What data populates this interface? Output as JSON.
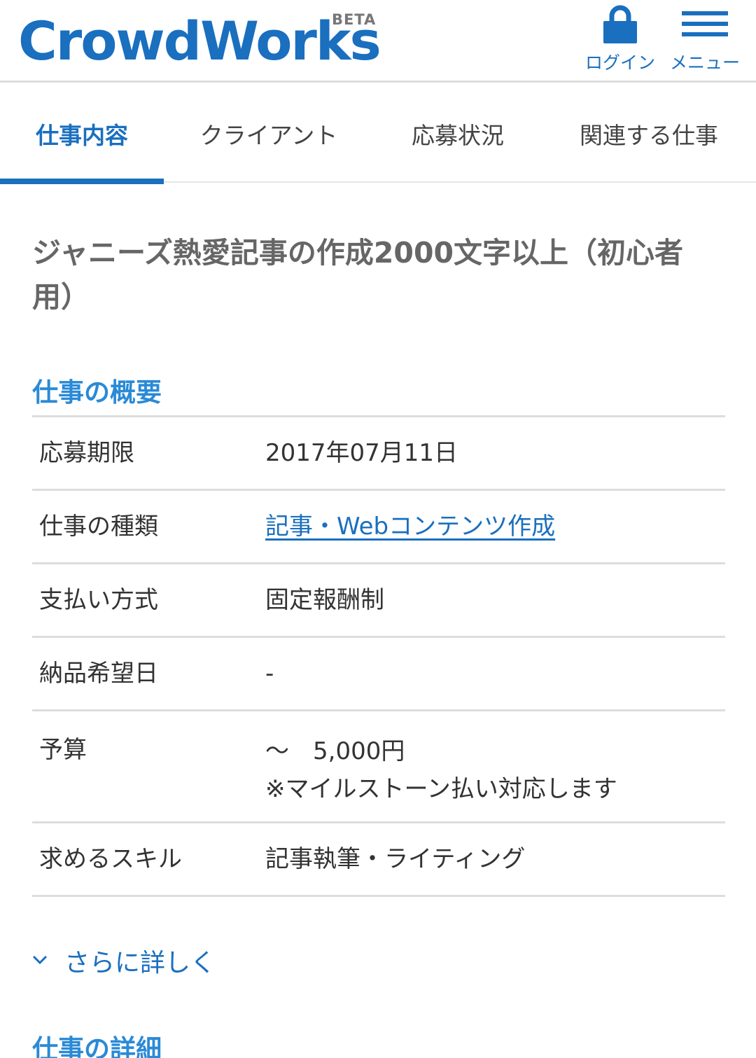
{
  "header": {
    "logo": "CrowdWorks",
    "logo_badge": "BETA",
    "login_label": "ログイン",
    "login_icon": "lock-icon",
    "menu_label": "メニュー",
    "menu_icon": "hamburger-icon",
    "accent_color": "#1a6fbf"
  },
  "tabs": [
    {
      "label": "仕事内容",
      "active": true
    },
    {
      "label": "クライアント",
      "active": false
    },
    {
      "label": "応募状況",
      "active": false
    },
    {
      "label": "関連する仕事",
      "active": false
    }
  ],
  "job": {
    "title": "ジャニーズ熱愛記事の作成2000文字以上（初心者用）"
  },
  "overview": {
    "heading": "仕事の概要",
    "rows": [
      {
        "label": "応募期限",
        "value": "2017年07月11日"
      },
      {
        "label": "仕事の種類",
        "value": "記事・Webコンテンツ作成"
      },
      {
        "label": "支払い方式",
        "value": "固定報酬制"
      },
      {
        "label": "納品希望日",
        "value": "-"
      },
      {
        "label": "予算",
        "value": "〜　5,000円",
        "note": "※マイルストーン払い対応します"
      },
      {
        "label": "求めるスキル",
        "value": "記事執筆・ライティング"
      }
    ],
    "more_label": "さらに詳しく",
    "more_icon": "chevron-down-icon"
  },
  "details": {
    "heading": "仕事の詳細"
  }
}
